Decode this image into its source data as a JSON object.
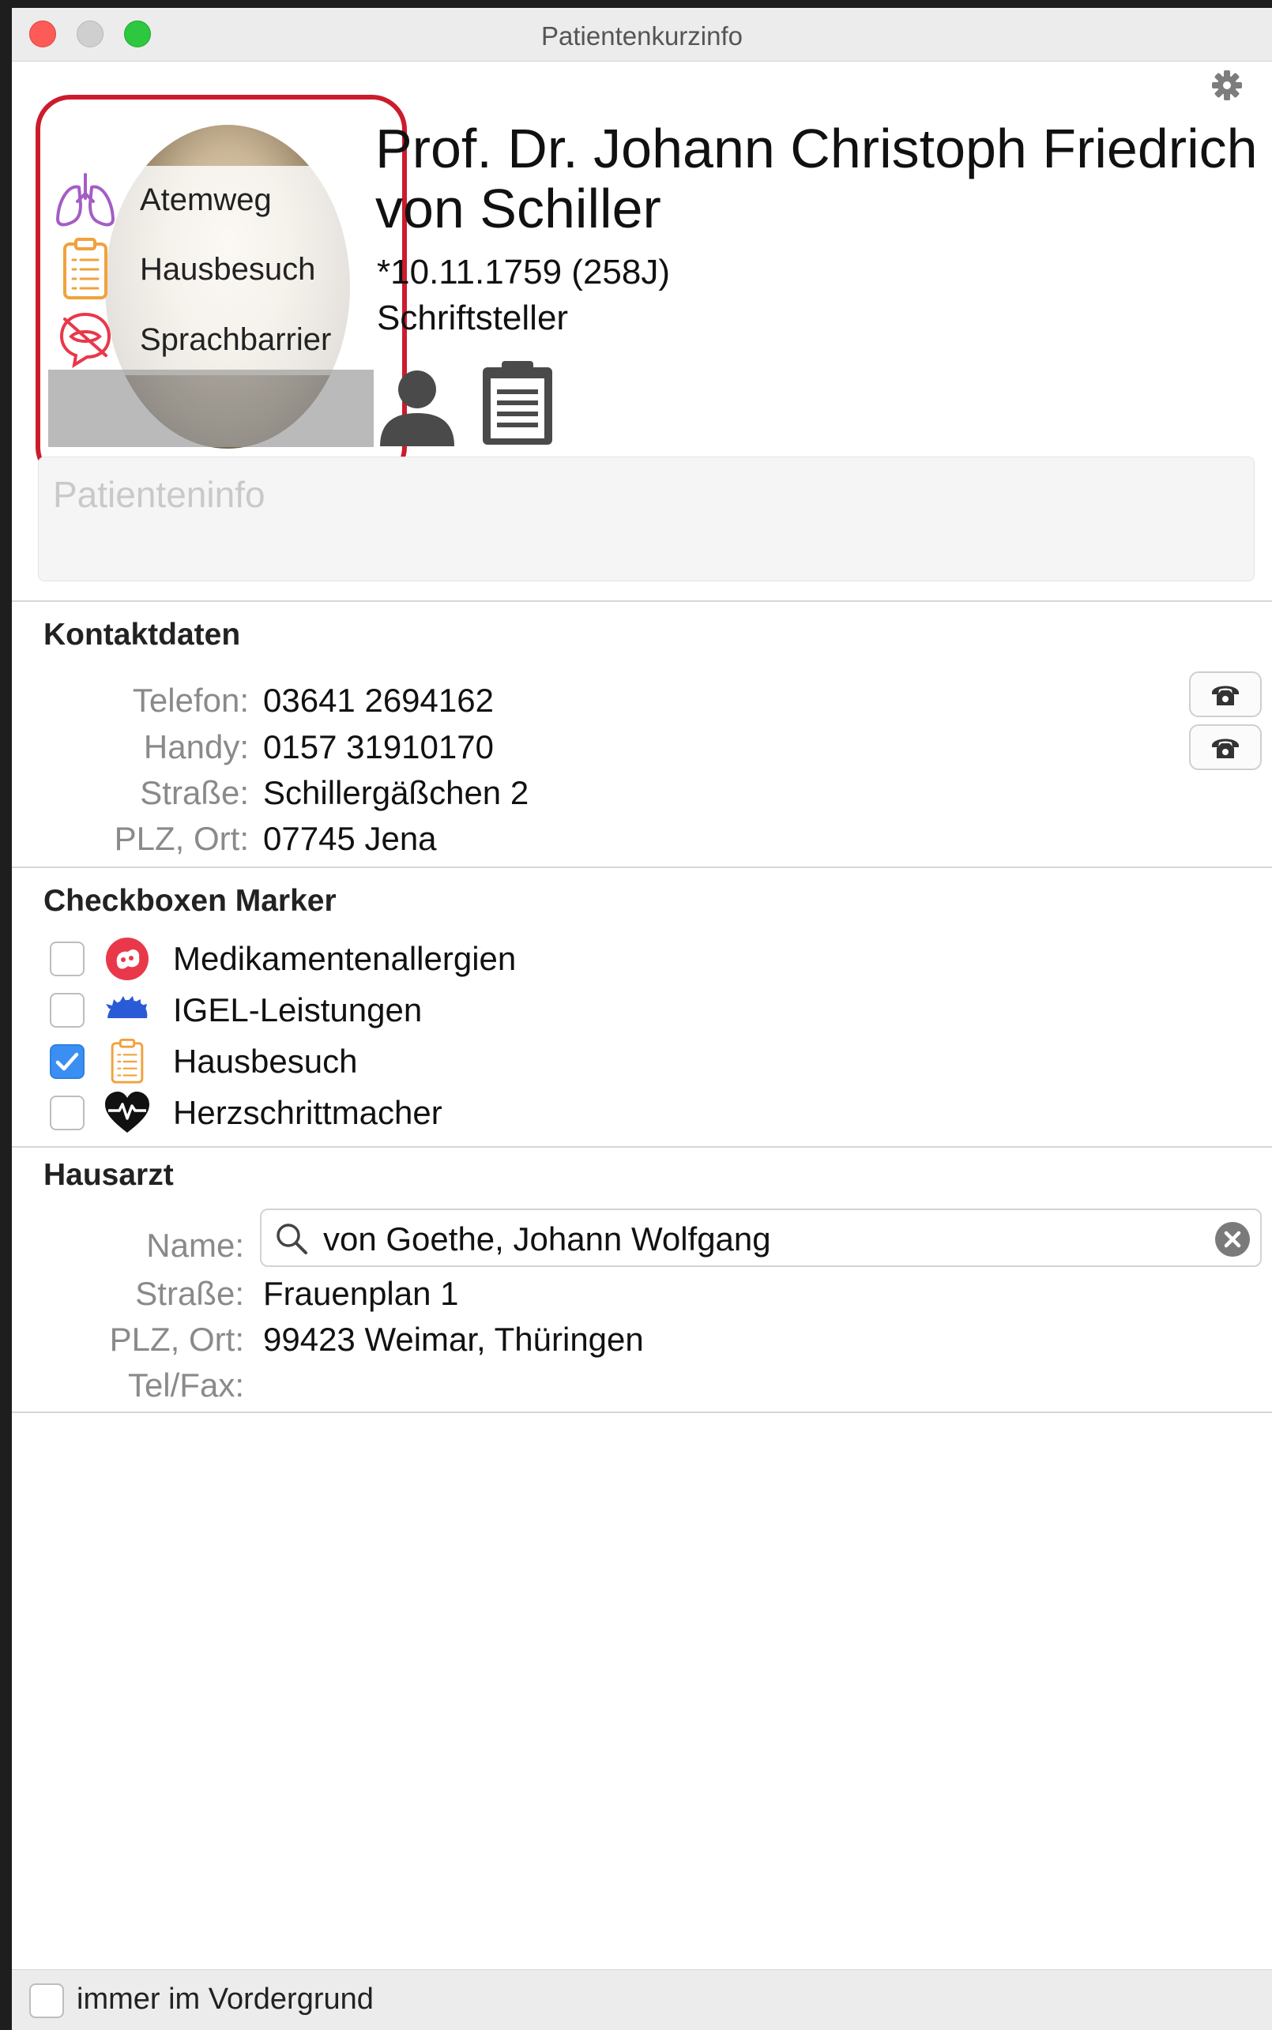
{
  "window": {
    "title": "Patientenkurzinfo"
  },
  "markers": [
    {
      "label": "Atemweg",
      "icon": "lungs-icon"
    },
    {
      "label": "Hausbesuch",
      "icon": "clipboard-icon"
    },
    {
      "label": "Sprachbarrier",
      "icon": "speech-barrier-icon"
    }
  ],
  "patient": {
    "name_line1": "Prof. Dr. Johann Christoph Friedrich",
    "name_line2": "von Schiller",
    "dob": "*10.11.1759 (258J)",
    "occupation": "Schriftsteller",
    "info_placeholder": "Patienteninfo"
  },
  "contact": {
    "title": "Kontaktdaten",
    "rows": [
      {
        "label": "Telefon:",
        "value": "03641 2694162"
      },
      {
        "label": "Handy:",
        "value": "0157 31910170"
      },
      {
        "label": "Straße:",
        "value": "Schillergäßchen 2"
      },
      {
        "label": "PLZ, Ort:",
        "value": "07745 Jena"
      }
    ]
  },
  "checkboxes": {
    "title": "Checkboxen Marker",
    "items": [
      {
        "label": "Medikamentenallergien",
        "checked": false,
        "icon": "allergy-icon"
      },
      {
        "label": "IGEL-Leistungen",
        "checked": false,
        "icon": "hedgehog-icon"
      },
      {
        "label": "Hausbesuch",
        "checked": true,
        "icon": "clipboard-icon"
      },
      {
        "label": "Herzschrittmacher",
        "checked": false,
        "icon": "heart-pulse-icon"
      }
    ]
  },
  "hausarzt": {
    "title": "Hausarzt",
    "name_label": "Name:",
    "name_value": "von Goethe, Johann Wolfgang",
    "rows": [
      {
        "label": "Straße:",
        "value": "Frauenplan 1"
      },
      {
        "label": "PLZ, Ort:",
        "value": "99423 Weimar, Thüringen"
      },
      {
        "label": "Tel/Fax:",
        "value": ""
      }
    ]
  },
  "footer": {
    "always_on_top_label": "immer im Vordergrund",
    "checked": false
  },
  "colors": {
    "accent": "#3b8ff3",
    "highlight_frame": "#cc1c2c",
    "allergy_red": "#e8384a",
    "igel_blue": "#2a5bd7",
    "clipboard_orange": "#f0a23c",
    "lungs_purple": "#a45dc5"
  }
}
